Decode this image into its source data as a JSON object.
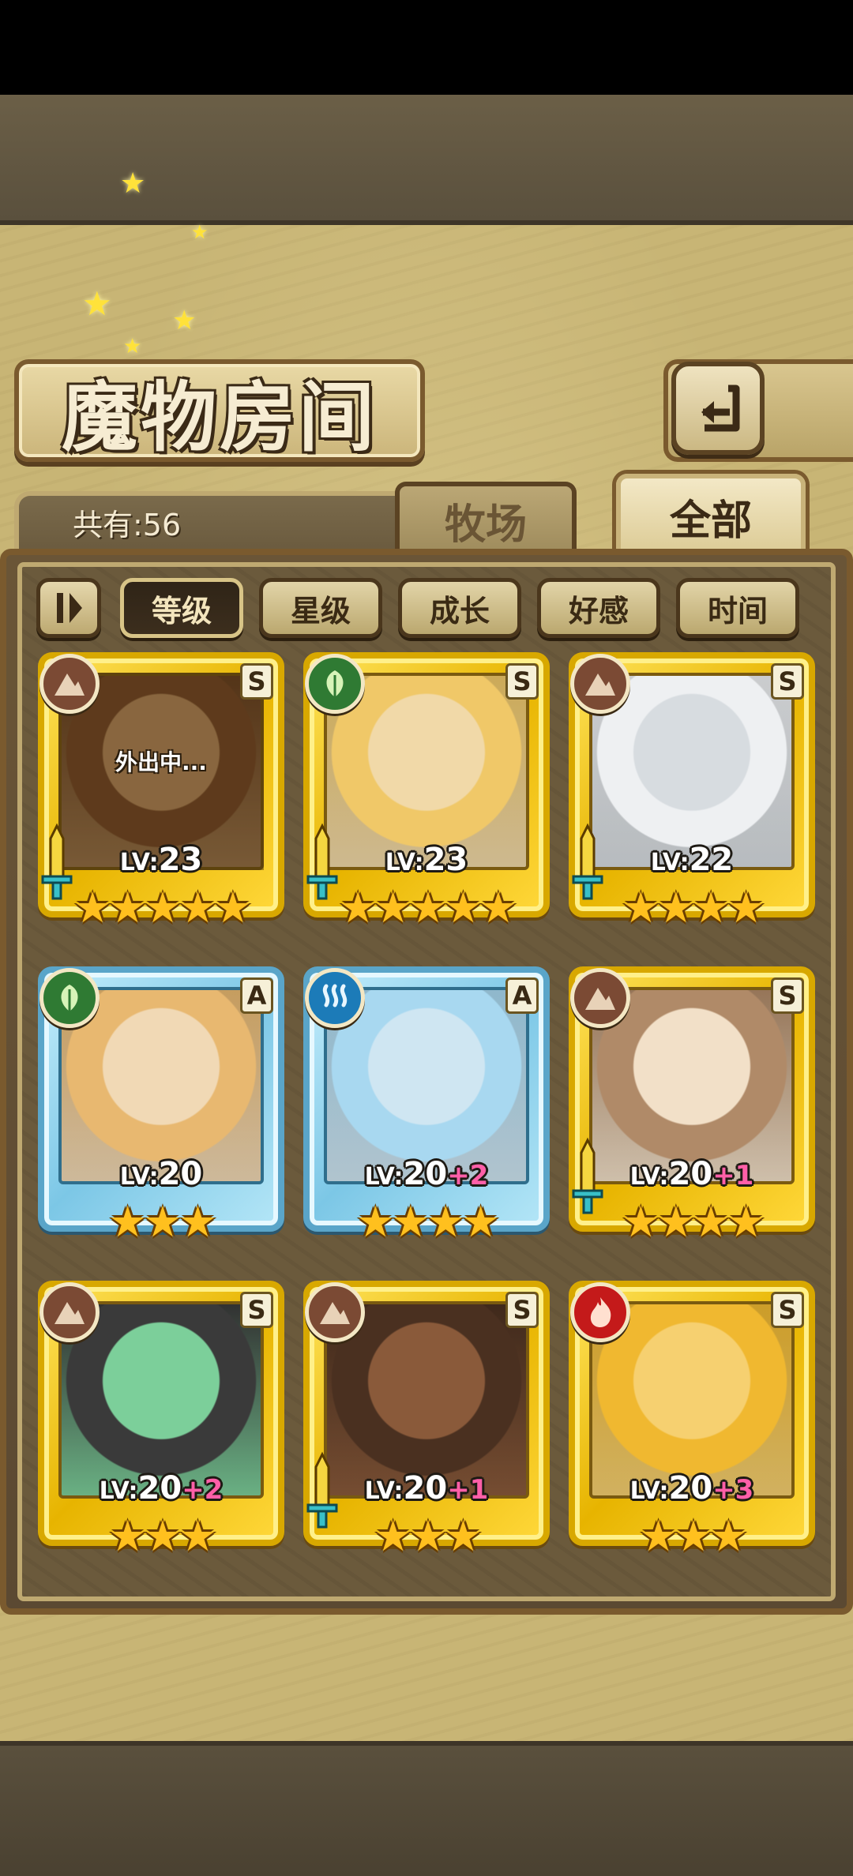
{
  "screen": {
    "title": "魔物房间",
    "monster_count_label": "共有:56"
  },
  "tabs": [
    {
      "label": "牧场",
      "active": false
    },
    {
      "label": "全部",
      "active": true
    }
  ],
  "sort": {
    "toggle_icon": "order-toggle-icon",
    "options": [
      {
        "label": "等级",
        "active": true
      },
      {
        "label": "星级",
        "active": false
      },
      {
        "label": "成长",
        "active": false
      },
      {
        "label": "好感",
        "active": false
      },
      {
        "label": "时间",
        "active": false
      }
    ]
  },
  "monsters": [
    {
      "rank": "S",
      "element": "earth",
      "lv_prefix": "LV:",
      "level": "23",
      "plus": "",
      "stars": "★★★★★",
      "weapon": true,
      "away_text": "外出中...",
      "portrait_color": "#c89a6a",
      "hair": "#7a4a2a"
    },
    {
      "rank": "S",
      "element": "plant",
      "lv_prefix": "LV:",
      "level": "23",
      "plus": "",
      "stars": "★★★★★",
      "weapon": true,
      "away_text": "",
      "portrait_color": "#f1d9a8",
      "hair": "#f0c868"
    },
    {
      "rank": "S",
      "element": "earth",
      "lv_prefix": "LV:",
      "level": "22",
      "plus": "",
      "stars": "★★★★",
      "weapon": true,
      "away_text": "",
      "portrait_color": "#d7dce0",
      "hair": "#eef0f2"
    },
    {
      "rank": "A",
      "element": "plant",
      "lv_prefix": "LV:",
      "level": "20",
      "plus": "",
      "stars": "★★★",
      "weapon": false,
      "away_text": "",
      "portrait_color": "#f1d9b5",
      "hair": "#e8b870"
    },
    {
      "rank": "A",
      "element": "water",
      "lv_prefix": "LV:",
      "level": "20",
      "plus": "+2",
      "stars": "★★★★",
      "weapon": false,
      "away_text": "",
      "portrait_color": "#cfe6f2",
      "hair": "#a8d8f0"
    },
    {
      "rank": "S",
      "element": "earth",
      "lv_prefix": "LV:",
      "level": "20",
      "plus": "+1",
      "stars": "★★★★",
      "weapon": true,
      "away_text": "",
      "portrait_color": "#f2e0c8",
      "hair": "#b08a68"
    },
    {
      "rank": "S",
      "element": "earth",
      "lv_prefix": "LV:",
      "level": "20",
      "plus": "+2",
      "stars": "★★★",
      "weapon": false,
      "away_text": "",
      "portrait_color": "#7ccf9a",
      "hair": "#3a3a3a"
    },
    {
      "rank": "S",
      "element": "earth",
      "lv_prefix": "LV:",
      "level": "20",
      "plus": "+1",
      "stars": "★★★",
      "weapon": true,
      "away_text": "",
      "portrait_color": "#8a5a3a",
      "hair": "#4a3020"
    },
    {
      "rank": "S",
      "element": "fire",
      "lv_prefix": "LV:",
      "level": "20",
      "plus": "+3",
      "stars": "★★★",
      "weapon": false,
      "away_text": "",
      "portrait_color": "#f6d070",
      "hair": "#f0b830"
    }
  ],
  "colors": {
    "gold_frame": "#e7b400",
    "blue_frame": "#7cc7e6",
    "plus_pink": "#ff5fa8",
    "star_gold": "#ffc01e"
  },
  "icons": {
    "back": "return-arrow-icon",
    "element_earth": "earth-element-icon",
    "element_plant": "leaf-element-icon",
    "element_water": "water-element-icon",
    "element_fire": "fire-element-icon",
    "weapon": "sword-icon"
  }
}
